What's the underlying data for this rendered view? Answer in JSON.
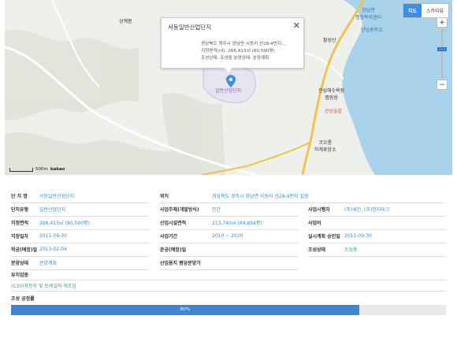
{
  "map": {
    "toggle": {
      "map": "지도",
      "skyview": "스카이뷰"
    },
    "labels": [
      {
        "id": "sanggyebong",
        "text": "상계봉"
      },
      {
        "id": "yangnam_welfare",
        "text": "양남면\n행정복지센터"
      },
      {
        "id": "yangnam_school",
        "text": "양남중학교"
      },
      {
        "id": "hwangseong",
        "text": "황성산"
      },
      {
        "id": "seodong_pin",
        "text": "일반산업단지"
      },
      {
        "id": "gwanseong_beach",
        "text": "관성해수욕장\n캠핑장"
      },
      {
        "id": "gwanseong_sol",
        "text": "관성솔밭"
      },
      {
        "id": "koolon",
        "text": "코오롱\n하계휴양소"
      }
    ],
    "popup": {
      "title": "서동일반산업단지",
      "address": "경상북도 경주시 양남면 서동리 산28-4번지...",
      "area": "지정면적(㎡): 266,413㎡ (80,590평)",
      "status": "조성상태: 조성중  분양상태: 분양계획"
    },
    "scale": "500m",
    "brand": "kakao"
  },
  "info": {
    "rows": [
      [
        {
          "k": "단 지 명",
          "v": "서동일반산업단지"
        },
        {
          "k": "위치",
          "v": "경상북도 경주시 양남면 서동리 산28-4번지 일원"
        },
        null
      ],
      [
        {
          "k": "단지유형",
          "v": "일반산업단지"
        },
        {
          "k": "사업주체(개발방식)",
          "v": "민간"
        },
        {
          "k": "사업시행자",
          "v": "(주)세진, (주)천지테크"
        }
      ],
      [
        {
          "k": "지정면적",
          "v": "266,413㎡ (80,590평)"
        },
        {
          "k": "산업시설면적",
          "v": "213,740㎡ (64,656평)"
        },
        {
          "k": "사업비",
          "v": ""
        }
      ],
      [
        {
          "k": "지정일자",
          "v": "2011-09-30"
        },
        {
          "k": "사업기간",
          "v": "2010 ~ 2020"
        },
        {
          "k": "실시계획 승인일",
          "v": "2011-09-30"
        }
      ],
      [
        {
          "k": "착공(예정)일",
          "v": "2013-02-04"
        },
        {
          "k": "준공(예정)일",
          "v": ""
        },
        {
          "k": "조성상태",
          "v": "조성중"
        }
      ],
      [
        {
          "k": "분양상태",
          "v": "분양계획"
        },
        {
          "k": "산업용지 평당분양가",
          "v": ""
        },
        null
      ]
    ],
    "industry_label": "유치업종",
    "industry_value": "(C30)자동차 및 트레일러 제조업"
  },
  "progress": {
    "title": "조성 공정률",
    "value": 0.8,
    "label": "80%"
  },
  "colors": {
    "accent": "#3e86cf",
    "link": "#3a8fc8",
    "green": "#3aa07a"
  }
}
